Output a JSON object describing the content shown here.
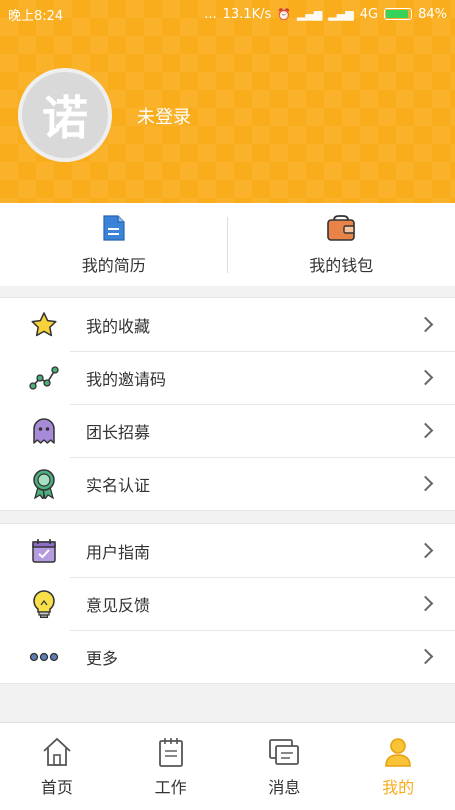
{
  "statusbar": {
    "time": "晚上8:24",
    "dots": "...",
    "speed": "13.1K/s",
    "network": "4G",
    "battery": "84%",
    "battery_level": 0.84
  },
  "profile": {
    "avatar_text": "诺",
    "login_status": "未登录"
  },
  "quick": {
    "resume_label": "我的简历",
    "wallet_label": "我的钱包"
  },
  "menu_group1": [
    {
      "label": "我的收藏",
      "icon": "star-icon"
    },
    {
      "label": "我的邀请码",
      "icon": "share-icon"
    },
    {
      "label": "团长招募",
      "icon": "ghost-icon"
    },
    {
      "label": "实名认证",
      "icon": "badge-icon"
    }
  ],
  "menu_group2": [
    {
      "label": "用户指南",
      "icon": "calendar-icon"
    },
    {
      "label": "意见反馈",
      "icon": "bulb-icon"
    },
    {
      "label": "更多",
      "icon": "more-icon"
    }
  ],
  "tabbar": {
    "home": "首页",
    "work": "工作",
    "messages": "消息",
    "me": "我的"
  },
  "colors": {
    "accent": "#f9ad1d"
  }
}
